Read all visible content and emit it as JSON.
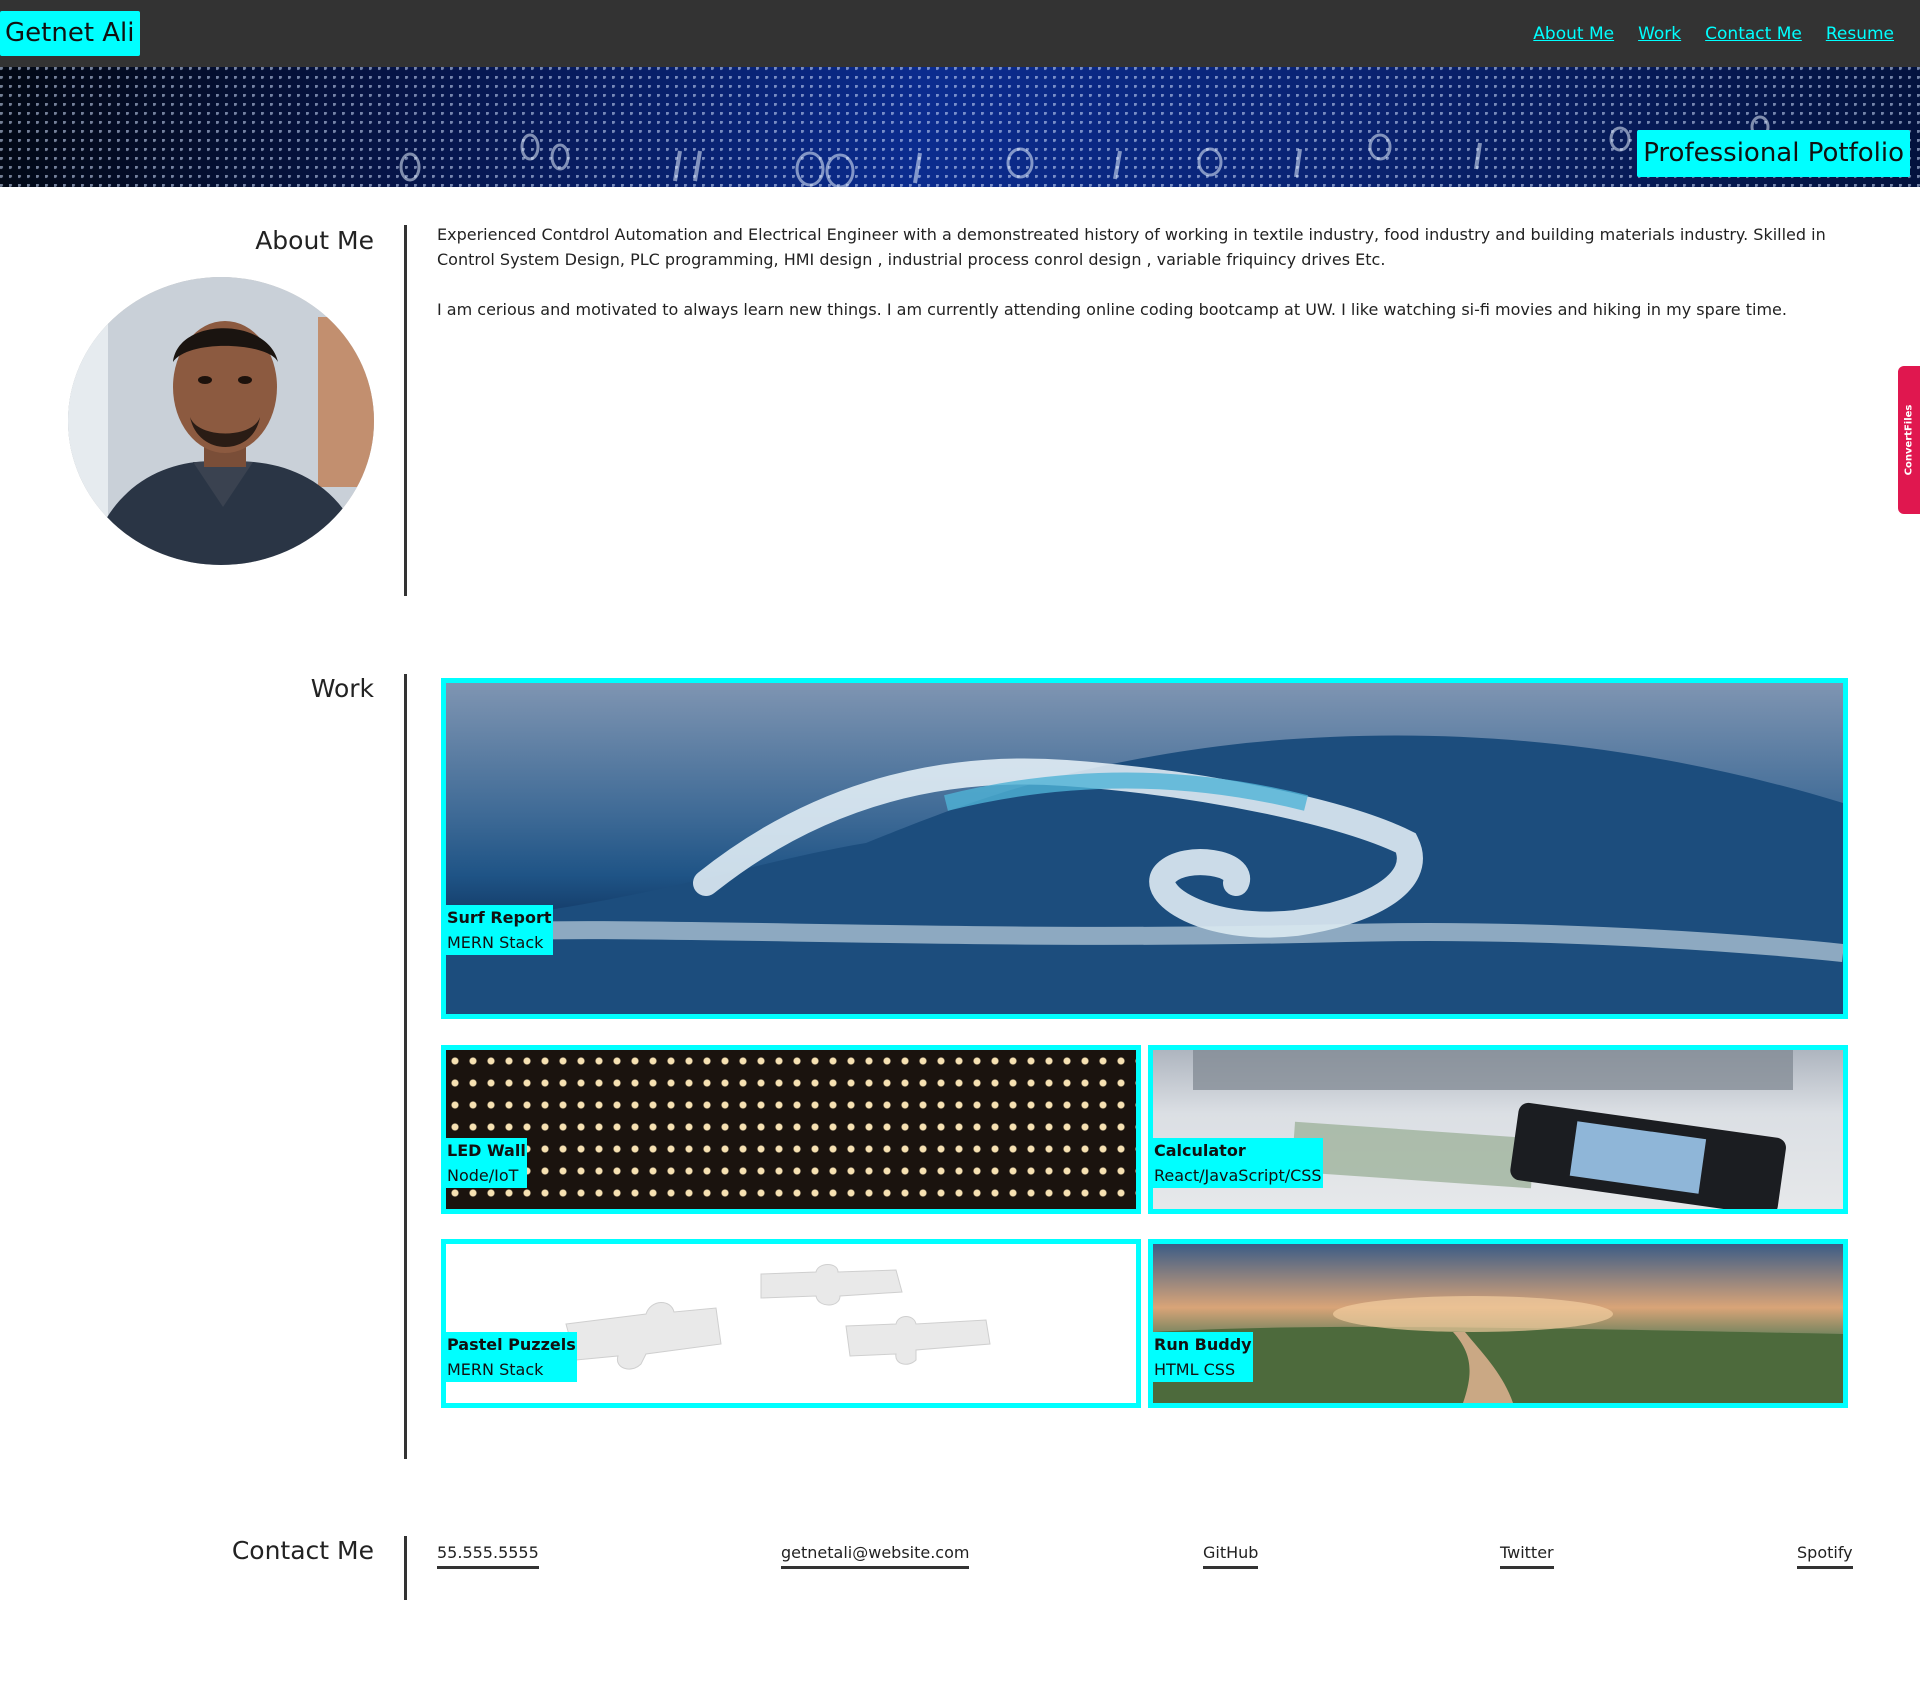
{
  "header": {
    "brand": "Getnet Ali",
    "nav": [
      "About Me",
      "Work",
      "Contact Me",
      "Resume"
    ],
    "hero_title": "Professional Potfolio"
  },
  "about": {
    "heading": "About Me",
    "paragraphs": [
      "Experienced Contdrol Automation and Electrical Engineer with a demonstreated history of working in textile industry, food industry and building materials industry. Skilled in Control System Design, PLC programming, HMI design , industrial process conrol design , variable friquincy drives Etc.",
      "I am cerious and motivated to always learn new things. I am currently attending online coding bootcamp at UW. I like watching si-fi movies and hiking in my spare time."
    ]
  },
  "work": {
    "heading": "Work",
    "projects": [
      {
        "title": "Surf Report",
        "tech": "MERN Stack"
      },
      {
        "title": "LED Wall",
        "tech": "Node/IoT"
      },
      {
        "title": "Calculator",
        "tech": "React/JavaScript/CSS"
      },
      {
        "title": "Pastel Puzzels",
        "tech": "MERN Stack"
      },
      {
        "title": "Run Buddy",
        "tech": "HTML CSS"
      }
    ]
  },
  "contact": {
    "heading": "Contact Me",
    "items": [
      "55.555.5555",
      "getnetali@website.com",
      "GitHub",
      "Twitter",
      "Spotify"
    ]
  },
  "side_tab": {
    "label": "ConvertFiles"
  },
  "colors": {
    "accent": "#00ffff",
    "header_bg": "#333333",
    "side_tab": "#e0174f"
  }
}
